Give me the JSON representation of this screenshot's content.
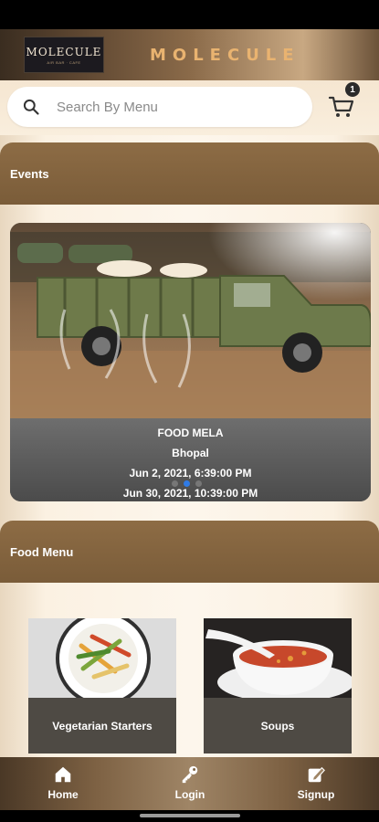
{
  "header": {
    "logo_text": "MOLECULE",
    "logo_subtext": "AIR BAR · CAFE",
    "title": "MOLECULE"
  },
  "search": {
    "placeholder": "Search By Menu",
    "value": ""
  },
  "cart": {
    "count": "1",
    "icon": "cart-icon"
  },
  "events": {
    "section_title": "Events",
    "items": [
      {
        "name": "FOOD MELA",
        "city": "Bhopal",
        "start": "Jun 2, 2021, 6:39:00 PM",
        "end": "Jun 30, 2021, 10:39:00 PM"
      }
    ],
    "carousel_page": 2,
    "carousel_total": 3
  },
  "food_menu": {
    "section_title": "Food Menu",
    "categories": [
      {
        "label": "Vegetarian Starters"
      },
      {
        "label": "Soups"
      }
    ]
  },
  "bottom_nav": {
    "items": [
      {
        "label": "Home",
        "icon": "home-icon"
      },
      {
        "label": "Login",
        "icon": "key-icon"
      },
      {
        "label": "Signup",
        "icon": "signup-icon"
      }
    ]
  },
  "colors": {
    "section_brown": "#8d6c45",
    "title_gold": "#e9b370",
    "carousel_active": "#2f7be6"
  }
}
